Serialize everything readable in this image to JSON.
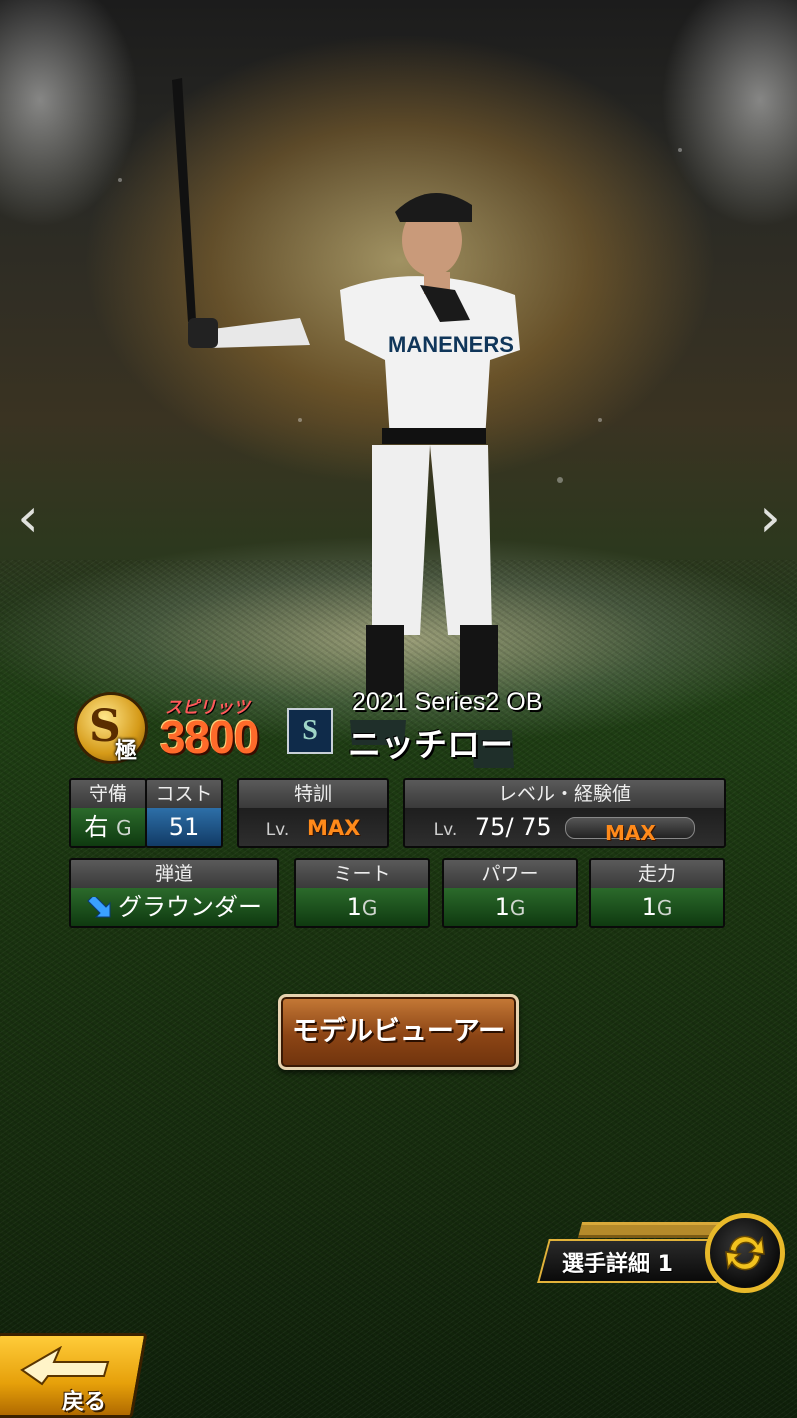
{
  "card": {
    "rank_letter": "S",
    "rank_sub": "極",
    "spirits_label": "スピリッツ",
    "spirits_value": "3800",
    "team_logo_letter": "S",
    "series": "2021 Series2 OB",
    "player_name": "ニッチロー"
  },
  "stats": {
    "position_header": "守備",
    "position_value": "右",
    "position_grade": "G",
    "cost_header": "コスト",
    "cost_value": "51",
    "training_header": "特訓",
    "training_lv": "Lv.",
    "training_value": "MAX",
    "level_header": "レベル・経験値",
    "level_lv": "Lv.",
    "level_value": "75/  75",
    "exp_label": "MAX",
    "trajectory_header": "弾道",
    "trajectory_value": "グラウンダー",
    "meet_header": "ミート",
    "meet_value": "1",
    "meet_grade": "G",
    "power_header": "パワー",
    "power_value": "1",
    "power_grade": "G",
    "speed_header": "走力",
    "speed_value": "1",
    "speed_grade": "G"
  },
  "buttons": {
    "model_viewer": "モデルビューアー",
    "player_detail": "選手詳細 1",
    "back": "戻る",
    "prev": "‹",
    "next": "›"
  },
  "colors": {
    "accent_gold": "#e8b92a",
    "max_orange": "#ff8a1a",
    "spirits_red": "#ff6a2a"
  }
}
